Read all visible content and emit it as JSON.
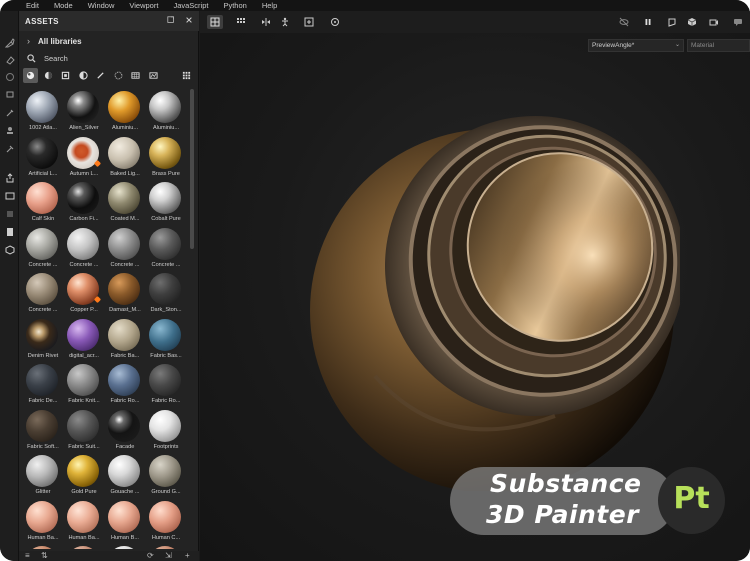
{
  "menubar": {
    "items": [
      "Edit",
      "Mode",
      "Window",
      "Viewport",
      "JavaScript",
      "Python",
      "Help"
    ]
  },
  "assets": {
    "title": "ASSETS",
    "library_label": "All libraries",
    "search_placeholder": "Search",
    "materials": [
      {
        "label": "1002 Atla...",
        "style": "radial-gradient(circle at 35% 30%, #eef2f7 0%, #9aa3b0 40%, #4b5260 80%, #22262c 100%)"
      },
      {
        "label": "Alien_Silver",
        "style": "radial-gradient(circle at 35% 30%, #ffffff 0%, #8d8d8d 18%, #121212 55%, #2a2a2a 100%)"
      },
      {
        "label": "Aluminiu...",
        "style": "radial-gradient(circle at 35% 30%, #fff1a8 0%, #e09a2a 35%, #8a4e0a 75%, #3a1f04 100%)"
      },
      {
        "label": "Aluminiu...",
        "style": "radial-gradient(circle at 35% 30%, #ffffff 0%, #c8c8c8 30%, #5a5a5a 70%, #1d1d1d 100%)"
      },
      {
        "label": "Artificial L...",
        "style": "radial-gradient(circle at 35% 30%, #8a8a8a 0%, #2a2a2a 30%, #0c0c0c 75%, #1a1a1a 100%)"
      },
      {
        "label": "Autumn L...",
        "style": "radial-gradient(circle at 45% 45%, #d05a2a 0%, #c44a20 25%, #e8e4df 45%, #cfc8c0 80%, #8a847c 100%)"
      },
      {
        "label": "Baked Lig...",
        "style": "radial-gradient(circle at 35% 30%, #f2ece0 0%, #c8bfae 45%, #7c7466 85%, #3a352e 100%)"
      },
      {
        "label": "Brass Pure",
        "style": "radial-gradient(circle at 35% 30%, #fff6c0 0%, #d8b45a 30%, #7a5c14 70%, #2a1f06 100%)"
      },
      {
        "label": "Calf Skin",
        "style": "radial-gradient(circle at 35% 30%, #ffe0d2 0%, #e8a08a 40%, #b0624c 80%, #6a3020 100%)"
      },
      {
        "label": "Carbon Fi...",
        "style": "radial-gradient(circle at 35% 30%, #e0e0e0 0%, #5a5a5a 20%, #0e0e0e 55%, #1e1e1e 100%)"
      },
      {
        "label": "Coated M...",
        "style": "radial-gradient(circle at 35% 30%, #e6e2cc 0%, #8e886e 40%, #4a4532 80%, #1e1c12 100%)"
      },
      {
        "label": "Cobalt Pure",
        "style": "radial-gradient(circle at 35% 30%, #ffffff 0%, #d2d2d2 30%, #6c6c6c 70%, #202020 100%)"
      },
      {
        "label": "Concrete ...",
        "style": "radial-gradient(circle at 35% 30%, #e8e8e4 0%, #a8a8a2 40%, #62625e 80%, #2a2a28 100%)"
      },
      {
        "label": "Concrete ...",
        "style": "radial-gradient(circle at 35% 30%, #f4f4f4 0%, #c4c4c4 40%, #7a7a7a 80%, #3a3a3a 100%)"
      },
      {
        "label": "Concrete ...",
        "style": "radial-gradient(circle at 35% 30%, #d0d0d0 0%, #8e8e8e 40%, #505050 80%, #222222 100%)"
      },
      {
        "label": "Concrete ...",
        "style": "radial-gradient(circle at 35% 30%, #9a9a9a 0%, #5a5a5a 40%, #2e2e2e 80%, #141414 100%)"
      },
      {
        "label": "Concrete ...",
        "style": "radial-gradient(circle at 35% 30%, #d4c8b8 0%, #9a8c78 40%, #5a4e3e 80%, #241e16 100%)"
      },
      {
        "label": "Copper P...",
        "style": "radial-gradient(circle at 35% 30%, #ffe4d0 0%, #e0906a 30%, #8a4024 70%, #2e1208 100%)"
      },
      {
        "label": "Damast_M...",
        "style": "radial-gradient(circle at 35% 30%, #d89a5a 0%, #8a5a2a 40%, #4a2c12 80%, #1e1206 100%)"
      },
      {
        "label": "Dark_Ston...",
        "style": "radial-gradient(circle at 35% 30%, #6e6e6e 0%, #3e3e3e 40%, #222222 80%, #101010 100%)"
      },
      {
        "label": "Denim Rivet",
        "style": "radial-gradient(circle at 40% 40%, #f0e6d0 0%, #b89868 18%, #3a2a1a 40%, #1a1a1e 75%, #2a2a30 100%)"
      },
      {
        "label": "digital_acr...",
        "style": "radial-gradient(circle at 35% 30%, #d8b8f0 0%, #8a5ab8 40%, #4a2a6e 80%, #1e1030 100%)"
      },
      {
        "label": "Fabric Ba...",
        "style": "radial-gradient(circle at 35% 30%, #e4dcc8 0%, #b0a48a 45%, #6e644e 85%, #2e2a20 100%)"
      },
      {
        "label": "Fabric Bas...",
        "style": "radial-gradient(circle at 35% 30%, #8ab8d0 0%, #3e6e8a 45%, #1e3a4e 85%, #0c1a24 100%)"
      },
      {
        "label": "Fabric De...",
        "style": "radial-gradient(circle at 35% 30%, #6a7078 0%, #3a4048 40%, #1e2228 80%, #0e1014 100%)"
      },
      {
        "label": "Fabric Knit...",
        "style": "radial-gradient(circle at 35% 30%, #c8c8c8 0%, #8a8a8a 40%, #4e4e4e 80%, #222222 100%)"
      },
      {
        "label": "Fabric Ro...",
        "style": "radial-gradient(circle at 35% 30%, #a8bcd4 0%, #5a7090 40%, #2e3e54 80%, #121a24 100%)"
      },
      {
        "label": "Fabric Ro...",
        "style": "radial-gradient(circle at 35% 30%, #7a7a7a 0%, #484848 40%, #262626 80%, #101010 100%)"
      },
      {
        "label": "Fabric Soft...",
        "style": "radial-gradient(circle at 35% 30%, #7a6a5a 0%, #4a3e32 40%, #2a221a 80%, #120e0a 100%)"
      },
      {
        "label": "Fabric Suit...",
        "style": "radial-gradient(circle at 35% 30%, #8a8a8a 0%, #555555 40%, #2e2e2e 80%, #141414 100%)"
      },
      {
        "label": "Facade",
        "style": "radial-gradient(circle at 35% 30%, #ffffff 0%, #6a6a6a 15%, #141414 45%, #1e1e1e 100%)"
      },
      {
        "label": "Footprints",
        "style": "radial-gradient(circle at 35% 30%, #ffffff 0%, #e4e4e4 35%, #9a9a9a 75%, #4a4a4a 100%)"
      },
      {
        "label": "Glitter",
        "style": "radial-gradient(circle at 35% 30%, #f0f0f0 0%, #b8b8b8 40%, #6e6e6e 80%, #2e2e2e 100%)"
      },
      {
        "label": "Gold Pure",
        "style": "radial-gradient(circle at 35% 30%, #fff4b0 0%, #e0b43a 30%, #8a6408 70%, #2e2004 100%)"
      },
      {
        "label": "Gouache ...",
        "style": "radial-gradient(circle at 35% 30%, #ffffff 0%, #d8d8d8 35%, #8e8e8e 75%, #3e3e3e 100%)"
      },
      {
        "label": "Ground G...",
        "style": "radial-gradient(circle at 35% 30%, #d8d4c8 0%, #9e988a 40%, #5a5648 80%, #242218 100%)"
      },
      {
        "label": "Human Ba...",
        "style": "radial-gradient(circle at 35% 30%, #ffe0d0 0%, #e8a890 40%, #b06a54 80%, #5a2e22 100%)"
      },
      {
        "label": "Human Ba...",
        "style": "radial-gradient(circle at 35% 30%, #ffe4d6 0%, #eaac94 40%, #b27058 80%, #5c3224 100%)"
      },
      {
        "label": "Human B...",
        "style": "radial-gradient(circle at 35% 30%, #ffe2d2 0%, #e6a68e 40%, #ae6852 80%, #582c20 100%)"
      },
      {
        "label": "Human C...",
        "style": "radial-gradient(circle at 35% 30%, #ffdccc 0%, #e49e86 40%, #aa624c 80%, #542a1e 100%)"
      },
      {
        "label": "",
        "style": "radial-gradient(circle at 35% 30%, #f0c8b0 0%, #c8886a 40%, #8a4e38 80%, #3e2016 100%)"
      },
      {
        "label": "",
        "style": "radial-gradient(circle at 35% 30%, #f0d0c0 0%, #c89078 40%, #8a5440 80%, #3e2218 100%)"
      },
      {
        "label": "",
        "style": "radial-gradient(circle at 35% 30%, #ffffff 0%, #dcdcdc 40%, #909090 80%, #404040 100%)"
      },
      {
        "label": "",
        "style": "radial-gradient(circle at 35% 30%, #f0c8b4 0%, #c88a70 40%, #8a4e3a 80%, #3e2018 100%)"
      }
    ]
  },
  "viewport": {
    "camera": "PreviewAngle*",
    "channel": "Material"
  },
  "logo": {
    "line1": "Substance",
    "line2": "3D Painter",
    "mark": "Pt"
  },
  "colors": {
    "accent_badge": "#ff7a1a",
    "logo_mark": "#b7e05a"
  }
}
